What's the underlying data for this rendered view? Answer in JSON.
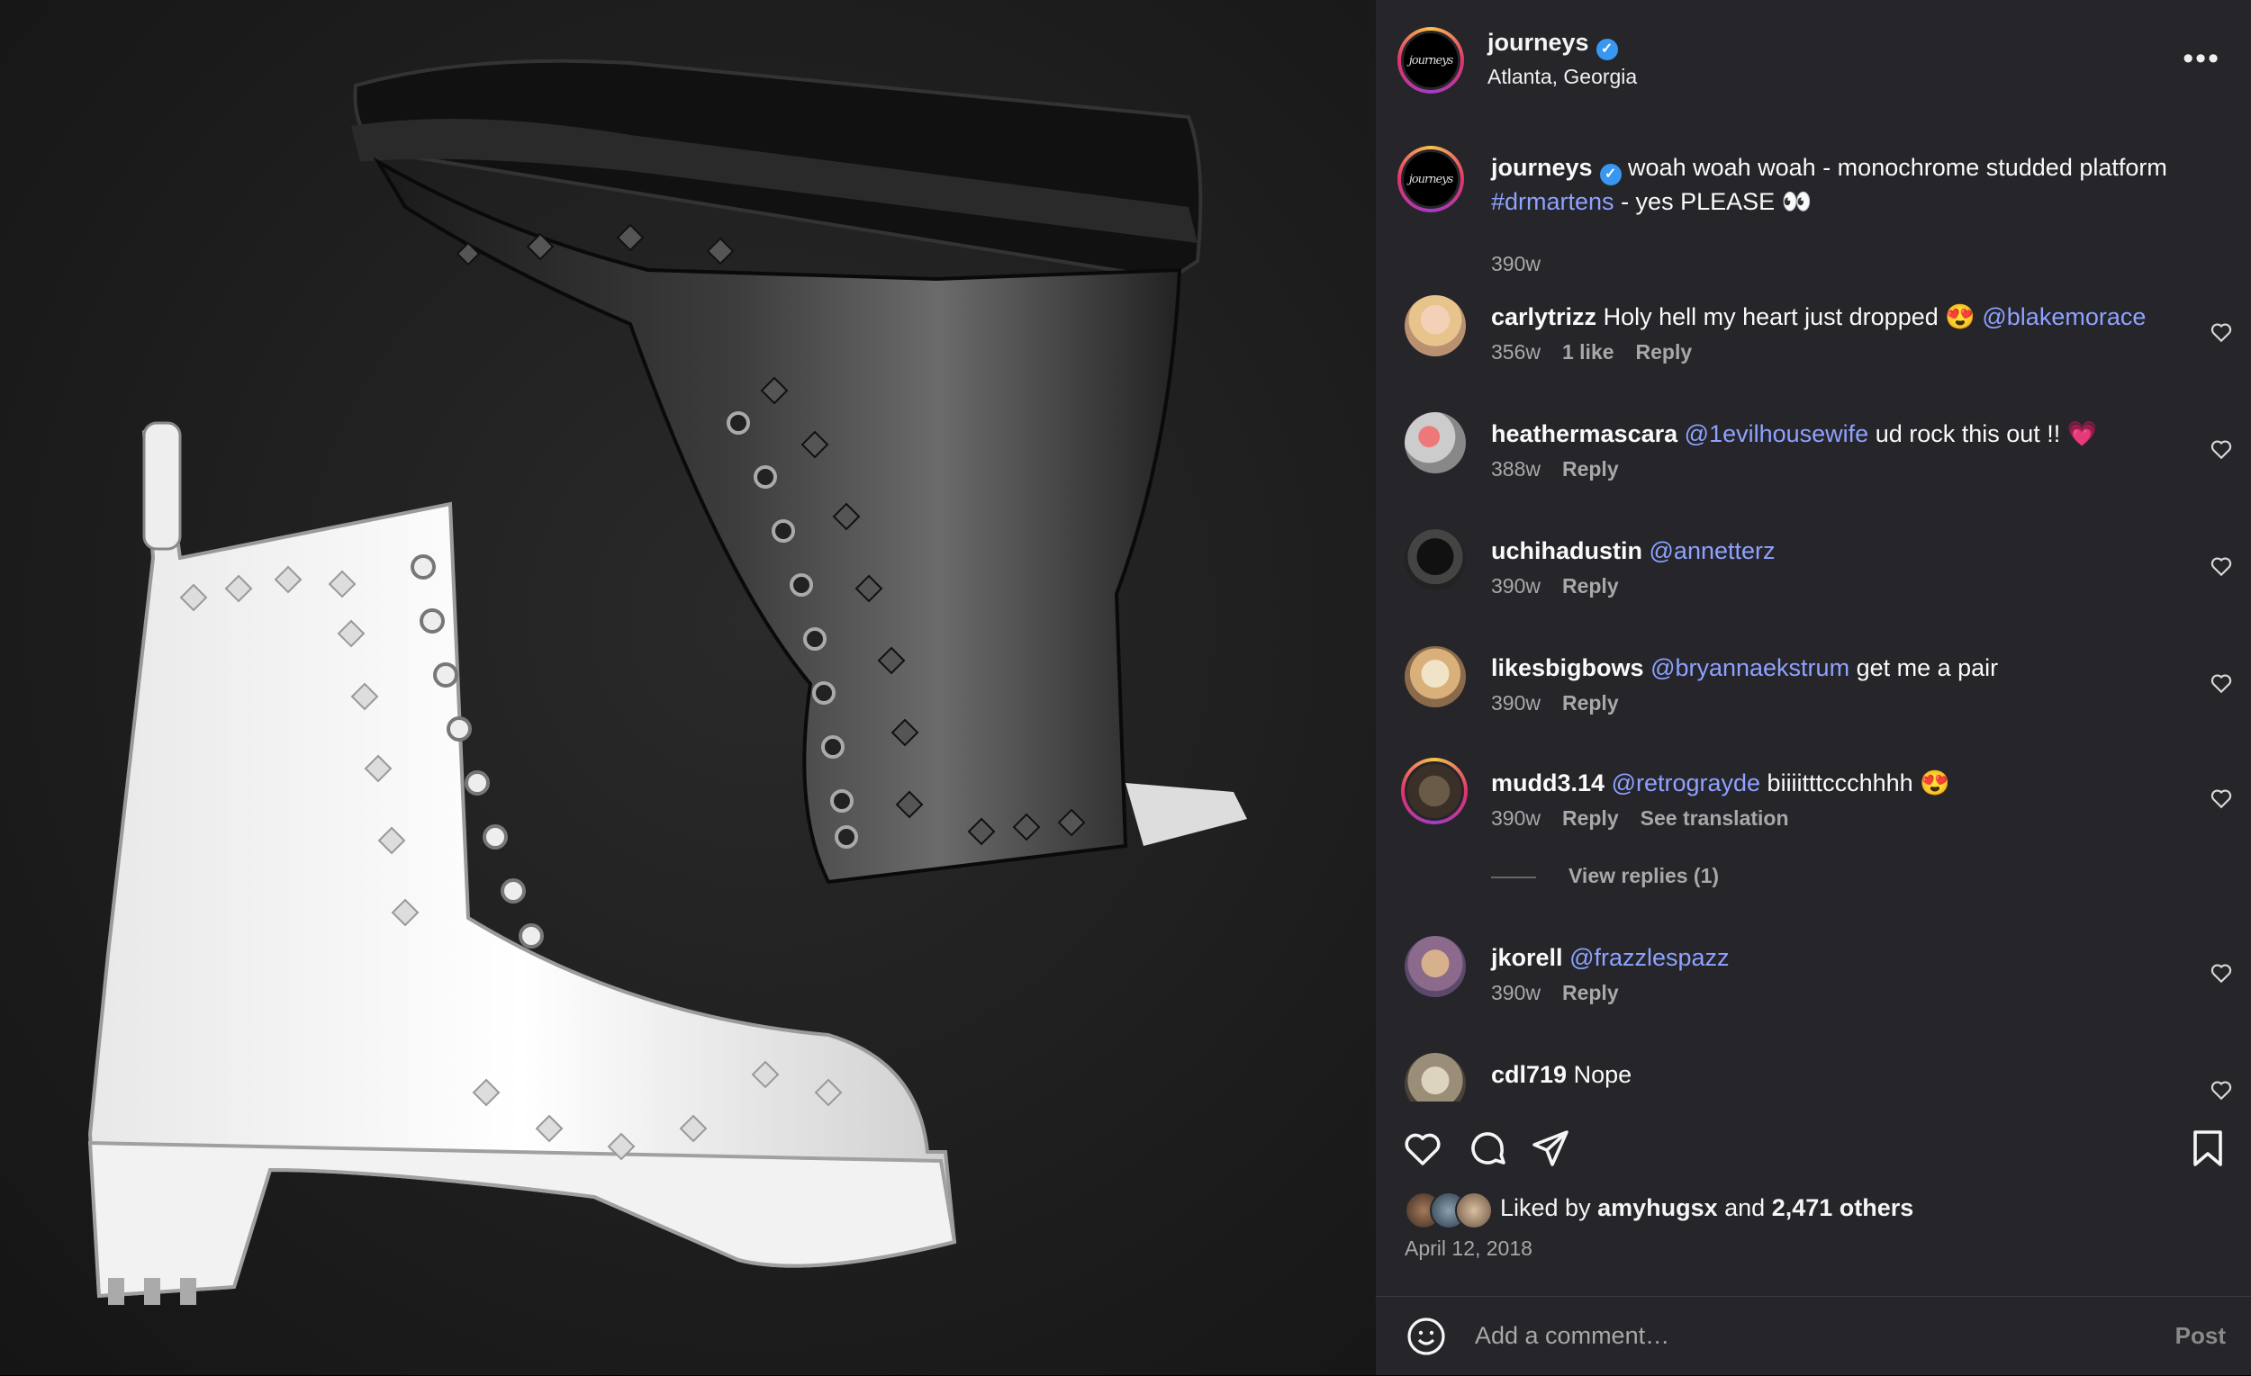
{
  "header": {
    "username": "journeys",
    "location": "Atlanta, Georgia",
    "avatar_text": "journeys",
    "more_label": "•••"
  },
  "caption": {
    "username": "journeys",
    "text": " woah woah woah - monochrome studded platform ",
    "hashtag": "#drmartens",
    "text2": " - yes PLEASE 👀",
    "time": "390w"
  },
  "comments": [
    {
      "user": "carlytrizz",
      "pre": " Holy hell my heart just dropped 😍 ",
      "mention": "@blakemorace",
      "post": "",
      "time": "356w",
      "likes": "1 like",
      "reply": "Reply",
      "extra": ""
    },
    {
      "user": "heathermascara",
      "pre": " ",
      "mention": "@1evilhousewife",
      "post": " ud rock this out !! 💗",
      "time": "388w",
      "likes": "",
      "reply": "Reply",
      "extra": ""
    },
    {
      "user": "uchihadustin",
      "pre": " ",
      "mention": "@annetterz",
      "post": "",
      "time": "390w",
      "likes": "",
      "reply": "Reply",
      "extra": ""
    },
    {
      "user": "likesbigbows",
      "pre": " ",
      "mention": "@bryannaekstrum",
      "post": " get me a pair",
      "time": "390w",
      "likes": "",
      "reply": "Reply",
      "extra": ""
    },
    {
      "user": "mudd3.14",
      "pre": " ",
      "mention": "@retrograyde",
      "post": " biiiitttccchhhh 😍",
      "time": "390w",
      "likes": "",
      "reply": "Reply",
      "extra": "See translation"
    },
    {
      "user": "jkorell",
      "pre": " ",
      "mention": "@frazzlespazz",
      "post": "",
      "time": "390w",
      "likes": "",
      "reply": "Reply",
      "extra": ""
    },
    {
      "user": "cdl719",
      "pre": " Nope",
      "mention": "",
      "post": "",
      "time": "",
      "likes": "",
      "reply": "",
      "extra": ""
    }
  ],
  "view_replies": "View replies (1)",
  "likes": {
    "prefix": "Liked by ",
    "user": "amyhugsx",
    "middle": " and ",
    "count": "2,471 others"
  },
  "date": "April 12, 2018",
  "add_comment": {
    "placeholder": "Add a comment…",
    "post_label": "Post"
  },
  "colors": {
    "panel_bg": "#25252a",
    "mention": "#8ea2ff",
    "verified": "#3897f0"
  }
}
